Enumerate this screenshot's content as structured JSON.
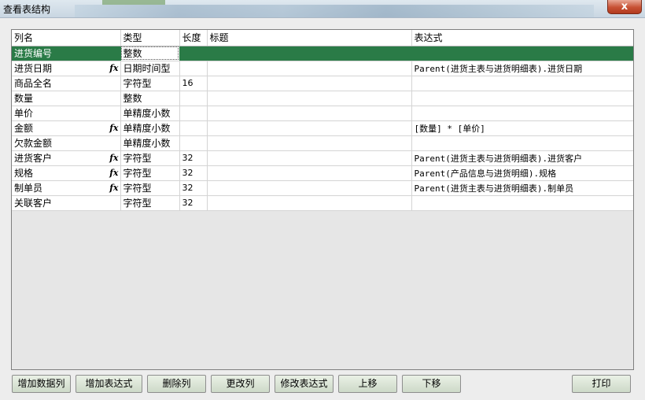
{
  "window": {
    "title": "查看表结构",
    "close_label": "x"
  },
  "grid": {
    "headers": {
      "name": "列名",
      "type": "类型",
      "length": "长度",
      "title": "标题",
      "expression": "表达式"
    },
    "rows": [
      {
        "name": "进货编号",
        "type": "整数",
        "length": "",
        "title": "",
        "expression": "",
        "fx": false
      },
      {
        "name": "进货日期",
        "type": "日期时间型",
        "length": "",
        "title": "",
        "expression": "Parent(进货主表与进货明细表).进货日期",
        "fx": true
      },
      {
        "name": "商品全名",
        "type": "字符型",
        "length": "16",
        "title": "",
        "expression": "",
        "fx": false
      },
      {
        "name": "数量",
        "type": "整数",
        "length": "",
        "title": "",
        "expression": "",
        "fx": false
      },
      {
        "name": "单价",
        "type": "单精度小数",
        "length": "",
        "title": "",
        "expression": "",
        "fx": false
      },
      {
        "name": "金额",
        "type": "单精度小数",
        "length": "",
        "title": "",
        "expression": "[数量] * [单价]",
        "fx": true
      },
      {
        "name": "欠款金额",
        "type": "单精度小数",
        "length": "",
        "title": "",
        "expression": "",
        "fx": false
      },
      {
        "name": "进货客户",
        "type": "字符型",
        "length": "32",
        "title": "",
        "expression": "Parent(进货主表与进货明细表).进货客户",
        "fx": true
      },
      {
        "name": "规格",
        "type": "字符型",
        "length": "32",
        "title": "",
        "expression": "Parent(产品信息与进货明细).规格",
        "fx": true
      },
      {
        "name": "制单员",
        "type": "字符型",
        "length": "32",
        "title": "",
        "expression": "Parent(进货主表与进货明细表).制单员",
        "fx": true
      },
      {
        "name": "关联客户",
        "type": "字符型",
        "length": "32",
        "title": "",
        "expression": "",
        "fx": false
      }
    ],
    "fx_label": "fx"
  },
  "buttons": {
    "add_data_column": "增加数据列",
    "add_expression": "增加表达式",
    "delete_column": "删除列",
    "change_column": "更改列",
    "modify_expression": "修改表达式",
    "move_up": "上移",
    "move_down": "下移",
    "print": "打印"
  },
  "colors": {
    "selected_row": "#2a7b47",
    "button_face": "#dbe6d6"
  }
}
